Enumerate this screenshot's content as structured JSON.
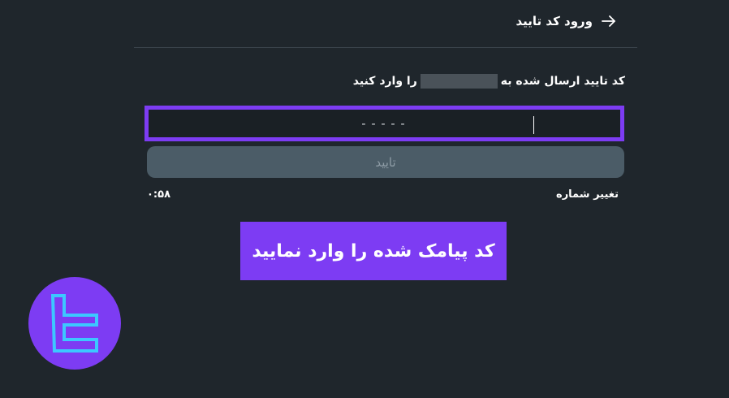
{
  "header": {
    "title": "ورود کد تایید",
    "back_icon": "arrow-right-icon"
  },
  "verification": {
    "instruction_before": "کد تایید ارسال شده به",
    "instruction_after": "را وارد کنید",
    "code_placeholder": "-----",
    "confirm_label": "تایید",
    "change_number_label": "تغییر شماره",
    "timer": "۰:۵۸"
  },
  "banner": {
    "text": "کد پیامک شده را وارد نمایید"
  },
  "colors": {
    "background": "#1f262c",
    "accent": "#7d3cf3",
    "button_disabled": "#4b5c67"
  },
  "logo": {
    "icon": "brand-logo-icon"
  }
}
